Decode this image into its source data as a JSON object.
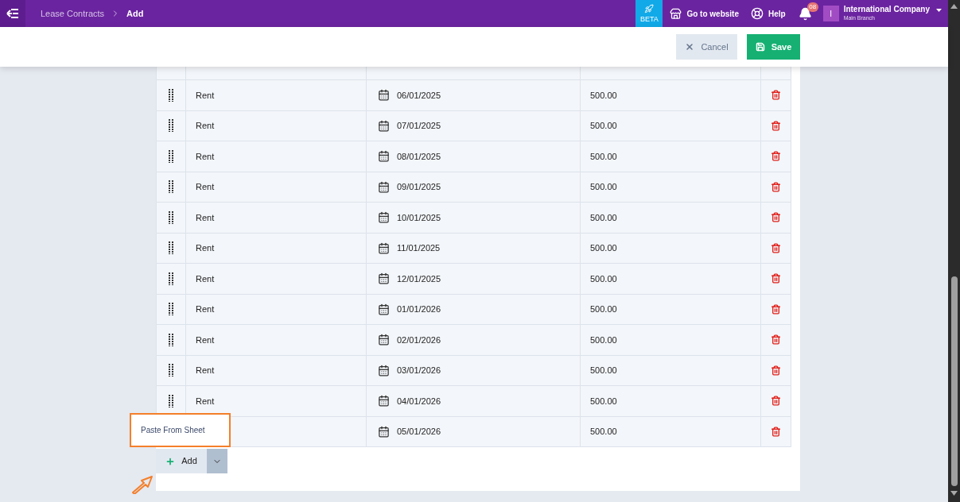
{
  "breadcrumb": [
    {
      "label": "Lease Contracts",
      "current": false
    },
    {
      "label": "Add",
      "current": true
    }
  ],
  "topbar": {
    "beta": "BETA",
    "website": "Go to website",
    "help": "Help",
    "notifications": "08",
    "avatar": "I",
    "company": "International Company",
    "branch": "Main Branch"
  },
  "actions": {
    "cancel": "Cancel",
    "save": "Save"
  },
  "rows": [
    {
      "type": "Rent",
      "date": "06/01/2025",
      "amount": "500.00"
    },
    {
      "type": "Rent",
      "date": "07/01/2025",
      "amount": "500.00"
    },
    {
      "type": "Rent",
      "date": "08/01/2025",
      "amount": "500.00"
    },
    {
      "type": "Rent",
      "date": "09/01/2025",
      "amount": "500.00"
    },
    {
      "type": "Rent",
      "date": "10/01/2025",
      "amount": "500.00"
    },
    {
      "type": "Rent",
      "date": "11/01/2025",
      "amount": "500.00"
    },
    {
      "type": "Rent",
      "date": "12/01/2025",
      "amount": "500.00"
    },
    {
      "type": "Rent",
      "date": "01/01/2026",
      "amount": "500.00"
    },
    {
      "type": "Rent",
      "date": "02/01/2026",
      "amount": "500.00"
    },
    {
      "type": "Rent",
      "date": "03/01/2026",
      "amount": "500.00"
    },
    {
      "type": "Rent",
      "date": "04/01/2026",
      "amount": "500.00"
    },
    {
      "date": "05/01/2026",
      "amount": "500.00"
    }
  ],
  "add_button": "Add",
  "add_menu": {
    "expanded": true,
    "items": [
      "Paste From Sheet"
    ]
  }
}
